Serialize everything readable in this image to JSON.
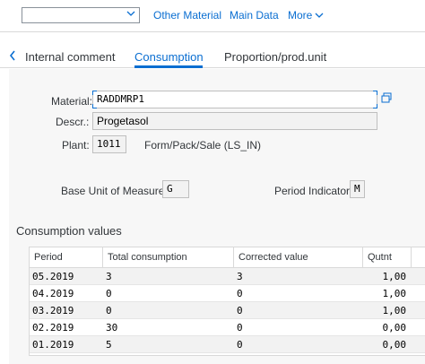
{
  "toolbar": {
    "dropdown_value": "",
    "links": [
      "Other Material",
      "Main Data",
      "More"
    ]
  },
  "tabs": {
    "items": [
      "Internal comment",
      "Consumption",
      "Proportion/prod.unit"
    ],
    "active": "Consumption"
  },
  "form": {
    "material_label": "Material:",
    "material_value": "RADDMRP1",
    "descr_label": "Descr.:",
    "descr_value": "Progetasol",
    "plant_label": "Plant:",
    "plant_value": "1011",
    "plant_text": "Form/Pack/Sale (LS_IN)",
    "base_uom_label": "Base Unit of Measure:",
    "base_uom_value": "G",
    "period_ind_label": "Period Indicator:",
    "period_ind_value": "M"
  },
  "consumption": {
    "title": "Consumption values",
    "columns": [
      "Period",
      "Total consumption",
      "Corrected value",
      "Qutnt"
    ],
    "rows": [
      {
        "period": "05.2019",
        "total": "3",
        "corrected": "3",
        "qutnt": "1,00"
      },
      {
        "period": "04.2019",
        "total": "0",
        "corrected": "0",
        "qutnt": "1,00"
      },
      {
        "period": "03.2019",
        "total": "0",
        "corrected": "0",
        "qutnt": "1,00"
      },
      {
        "period": "02.2019",
        "total": "30",
        "corrected": "0",
        "qutnt": "0,00"
      },
      {
        "period": "01.2019",
        "total": "5",
        "corrected": "0",
        "qutnt": "0,00"
      }
    ]
  },
  "colors": {
    "accent": "#0a6ed1",
    "panel_bg": "#f7f7f7",
    "row_alt": "#f2f2f2"
  },
  "icons": {
    "dropdown": "chevron-down-icon",
    "more": "chevron-down-icon",
    "tab_prev": "chevron-left-icon",
    "value_help": "value-help-icon"
  }
}
